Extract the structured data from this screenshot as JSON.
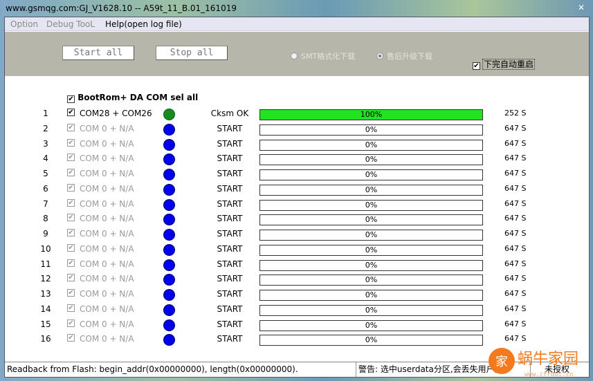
{
  "window": {
    "title": "www.gsmqg.com:GJ_V1628.10 -- A59t_11_B.01_161019",
    "close": "✕"
  },
  "menu": [
    "Option",
    "Debug TooL",
    "Help(open log file)"
  ],
  "toolbar": {
    "start_all": "Start all",
    "stop_all": "Stop all",
    "radio_smt": "SMT格式化下载",
    "radio_after_sale": "售后升级下载",
    "radio_selected": "售后升级下载",
    "auto_reboot": "下完自动重启",
    "auto_reboot_checked": true
  },
  "select_all": {
    "label": "BootRom+ DA COM sel all",
    "checked": true
  },
  "rows": [
    {
      "n": "1",
      "port": "COM28 + COM26",
      "state": "Cksm OK",
      "progress": 100,
      "pct": "100%",
      "time": "252 S",
      "enabled": true
    },
    {
      "n": "2",
      "port": "COM 0 + N/A",
      "state": "START",
      "progress": 0,
      "pct": "0%",
      "time": "647 S"
    },
    {
      "n": "3",
      "port": "COM 0 + N/A",
      "state": "START",
      "progress": 0,
      "pct": "0%",
      "time": "647 S"
    },
    {
      "n": "4",
      "port": "COM 0 + N/A",
      "state": "START",
      "progress": 0,
      "pct": "0%",
      "time": "647 S"
    },
    {
      "n": "5",
      "port": "COM 0 + N/A",
      "state": "START",
      "progress": 0,
      "pct": "0%",
      "time": "647 S"
    },
    {
      "n": "6",
      "port": "COM 0 + N/A",
      "state": "START",
      "progress": 0,
      "pct": "0%",
      "time": "647 S"
    },
    {
      "n": "7",
      "port": "COM 0 + N/A",
      "state": "START",
      "progress": 0,
      "pct": "0%",
      "time": "647 S"
    },
    {
      "n": "8",
      "port": "COM 0 + N/A",
      "state": "START",
      "progress": 0,
      "pct": "0%",
      "time": "647 S"
    },
    {
      "n": "9",
      "port": "COM 0 + N/A",
      "state": "START",
      "progress": 0,
      "pct": "0%",
      "time": "647 S"
    },
    {
      "n": "10",
      "port": "COM 0 + N/A",
      "state": "START",
      "progress": 0,
      "pct": "0%",
      "time": "647 S"
    },
    {
      "n": "11",
      "port": "COM 0 + N/A",
      "state": "START",
      "progress": 0,
      "pct": "0%",
      "time": "647 S"
    },
    {
      "n": "12",
      "port": "COM 0 + N/A",
      "state": "START",
      "progress": 0,
      "pct": "0%",
      "time": "647 S"
    },
    {
      "n": "13",
      "port": "COM 0 + N/A",
      "state": "START",
      "progress": 0,
      "pct": "0%",
      "time": "647 S"
    },
    {
      "n": "14",
      "port": "COM 0 + N/A",
      "state": "START",
      "progress": 0,
      "pct": "0%",
      "time": "647 S"
    },
    {
      "n": "15",
      "port": "COM 0 + N/A",
      "state": "START",
      "progress": 0,
      "pct": "0%",
      "time": "647 S"
    },
    {
      "n": "16",
      "port": "COM 0 + N/A",
      "state": "START",
      "progress": 0,
      "pct": "0%",
      "time": "647 S"
    }
  ],
  "status": {
    "readback": "Readback from Flash:  begin_addr(0x00000000), length(0x00000000).",
    "warning": "警告: 选中userdata分区,会丢失用户数",
    "auth": "未授权"
  },
  "watermark": {
    "text": "蜗牛家园",
    "url": "www.cfroot.cn",
    "logo": "家"
  },
  "colors": {
    "ok_dot": "#1a8a1a",
    "idle_dot": "#0000ee",
    "progress_fill": "#22e322",
    "panel": "#b6b6aa"
  }
}
